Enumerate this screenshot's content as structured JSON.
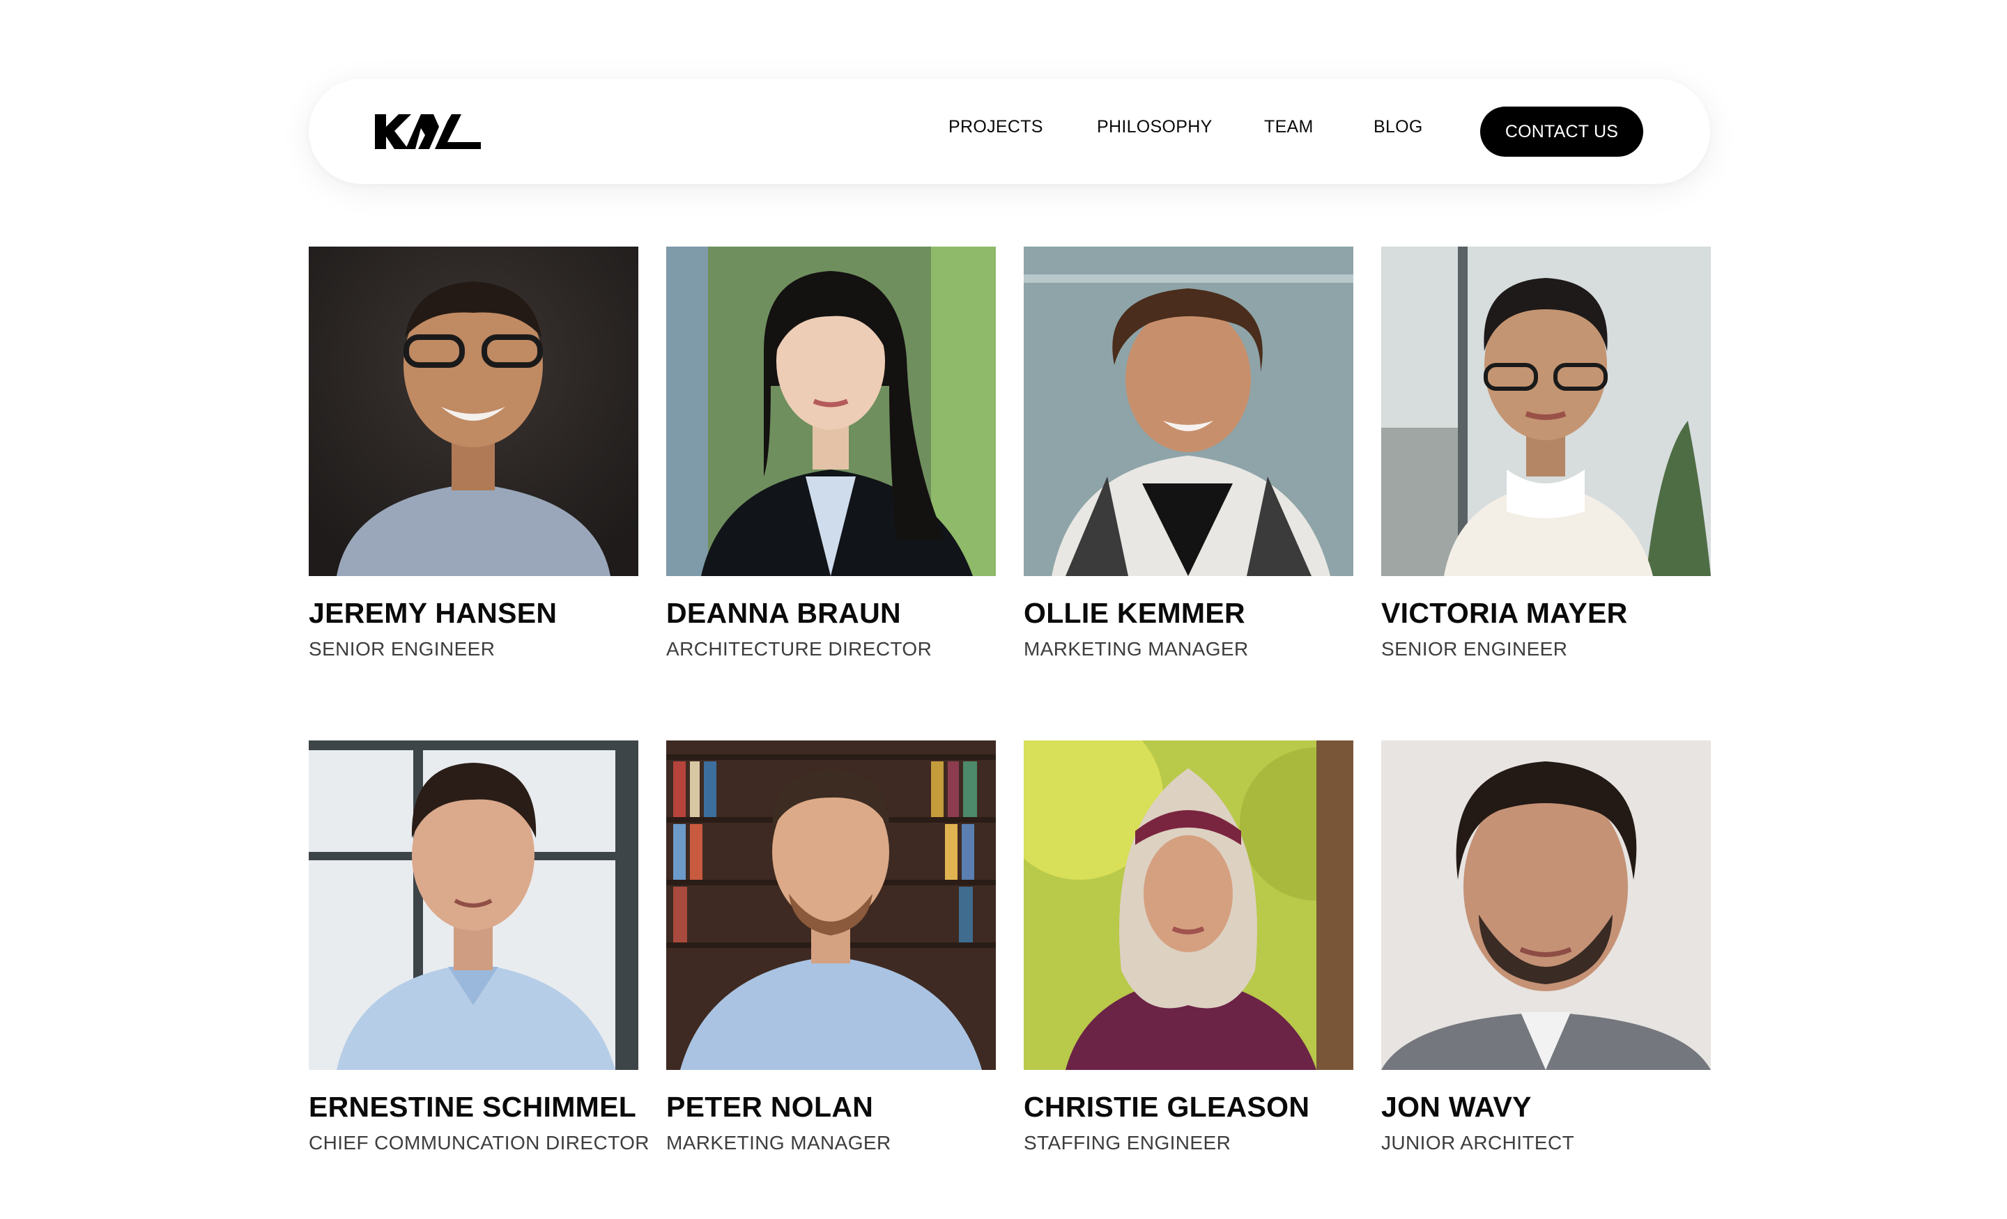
{
  "brand": {
    "logo_text": "KAL",
    "icon": "kal-logo-icon"
  },
  "nav": {
    "items": [
      {
        "label": "PROJECTS"
      },
      {
        "label": "PHILOSOPHY"
      },
      {
        "label": "TEAM"
      },
      {
        "label": "BLOG"
      }
    ],
    "cta_label": "CONTACT US"
  },
  "team": {
    "members": [
      {
        "name": "JEREMY HANSEN",
        "role": "SENIOR ENGINEER",
        "photo": "portrait-photo"
      },
      {
        "name": "DEANNA BRAUN",
        "role": "ARCHITECTURE DIRECTOR",
        "photo": "portrait-photo"
      },
      {
        "name": "OLLIE KEMMER",
        "role": "MARKETING MANAGER",
        "photo": "portrait-photo"
      },
      {
        "name": "VICTORIA MAYER",
        "role": "SENIOR ENGINEER",
        "photo": "portrait-photo"
      },
      {
        "name": "ERNESTINE SCHIMMEL",
        "role": "CHIEF COMMUNCATION DIRECTOR",
        "photo": "portrait-photo"
      },
      {
        "name": "PETER NOLAN",
        "role": "MARKETING MANAGER",
        "photo": "portrait-photo"
      },
      {
        "name": "CHRISTIE GLEASON",
        "role": "STAFFING ENGINEER",
        "photo": "portrait-photo"
      },
      {
        "name": "JON WAVY",
        "role": "JUNIOR ARCHITECT",
        "photo": "portrait-photo"
      }
    ]
  },
  "colors": {
    "background": "#ffffff",
    "text": "#0a0a0a",
    "muted_text": "#3d3d3d",
    "cta_background": "#000000",
    "cta_text": "#ffffff"
  }
}
